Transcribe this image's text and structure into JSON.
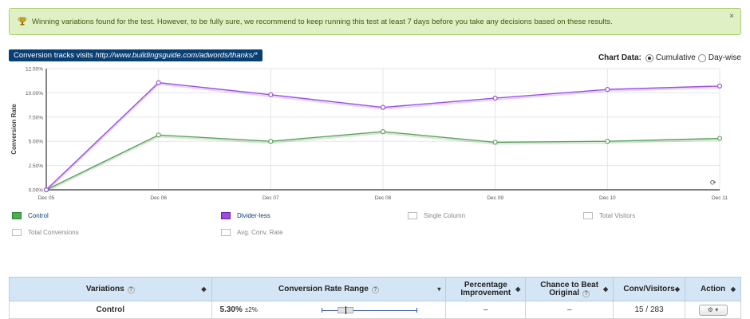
{
  "alert": {
    "text": "Winning variations found for the test. However, to be fully sure, we recommend to keep running this test at least 7 days before you take any decisions based on these results.",
    "close": "×"
  },
  "tracks": {
    "prefix": "Conversion tracks visits ",
    "url": "http://www.buildingsguide.com/adwords/thanks/*"
  },
  "chart_controls": {
    "label": "Chart Data:",
    "option_cumulative": "Cumulative",
    "option_daywise": "Day-wise",
    "selected": "Cumulative"
  },
  "chart_data": {
    "type": "line",
    "ylabel": "Conversion Rate",
    "x": [
      "Dec 05",
      "Dec 06",
      "Dec 07",
      "Dec 08",
      "Dec 09",
      "Dec 10",
      "Dec 11"
    ],
    "ylim": [
      0,
      12.5
    ],
    "yticks": [
      "0.00%",
      "2.50%",
      "5.00%",
      "7.50%",
      "10.00%",
      "12.50%"
    ],
    "grid": true,
    "series": [
      {
        "name": "Control",
        "color": "#5aa05a",
        "values": [
          0,
          5.65,
          5.0,
          6.0,
          4.9,
          5.0,
          5.3
        ]
      },
      {
        "name": "Divider-less",
        "color": "#9b4fdc",
        "values": [
          0,
          11.05,
          9.8,
          8.5,
          9.45,
          10.35,
          10.7
        ]
      }
    ]
  },
  "legend": {
    "items": [
      {
        "label": "Control",
        "color": "#4caf50",
        "active": true
      },
      {
        "label": "Divider-less",
        "color": "#9c4ddb",
        "active": true
      },
      {
        "label": "Single Column",
        "color": "#ffffff",
        "active": false
      },
      {
        "label": "Total Visitors",
        "color": "#ffffff",
        "active": false
      },
      {
        "label": "Total Conversions",
        "color": "#ffffff",
        "active": false
      },
      {
        "label": "Avg. Conv. Rate",
        "color": "#ffffff",
        "active": false
      }
    ]
  },
  "table": {
    "headers": {
      "variations": "Variations",
      "range": "Conversion Rate Range",
      "improvement_l1": "Percentage",
      "improvement_l2": "Improvement",
      "chance_l1": "Chance to Beat",
      "chance_l2": "Original",
      "conv": "Conv/Visitors",
      "action": "Action"
    },
    "help_mark": "?",
    "rows": [
      {
        "name": "Control",
        "rate": "5.30%",
        "pm": "±2%",
        "improvement": "–",
        "chance": "–",
        "conv": "15 / 283",
        "action": "⚙ ▾"
      }
    ]
  }
}
